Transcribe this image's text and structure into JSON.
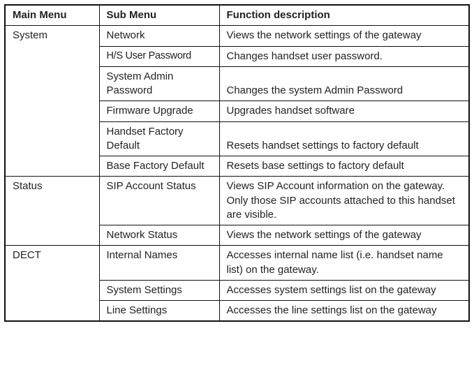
{
  "headers": {
    "main": "Main Menu",
    "sub": "Sub Menu",
    "desc": "Function description"
  },
  "groups": [
    {
      "main": "System",
      "rows": [
        {
          "sub": "Network",
          "desc": "Views the network settings of the gateway"
        },
        {
          "sub": "H/S User Password",
          "desc": "Changes handset user password."
        },
        {
          "sub": "System Admin Password",
          "desc": "Changes the system Admin Password"
        },
        {
          "sub": "Firmware Upgrade",
          "desc": "Upgrades handset software"
        },
        {
          "sub": "Handset Factory Default",
          "desc": "Resets handset settings to factory default"
        },
        {
          "sub": "Base Factory Default",
          "desc": "Resets base settings to factory default"
        }
      ]
    },
    {
      "main": "Status",
      "rows": [
        {
          "sub": "SIP Account Status",
          "desc": "Views SIP Account information on the gateway. Only those SIP accounts attached to this handset are visible."
        },
        {
          "sub": "Network Status",
          "desc": "Views the network settings of the gateway"
        }
      ]
    },
    {
      "main": "DECT",
      "rows": [
        {
          "sub": "Internal Names",
          "desc": "Accesses internal name list (i.e. handset name list) on the gateway."
        },
        {
          "sub": "System Settings",
          "desc": "Accesses system settings list on the gateway"
        },
        {
          "sub": "Line Settings",
          "desc": "Accesses the line settings list on the gateway"
        }
      ]
    }
  ]
}
